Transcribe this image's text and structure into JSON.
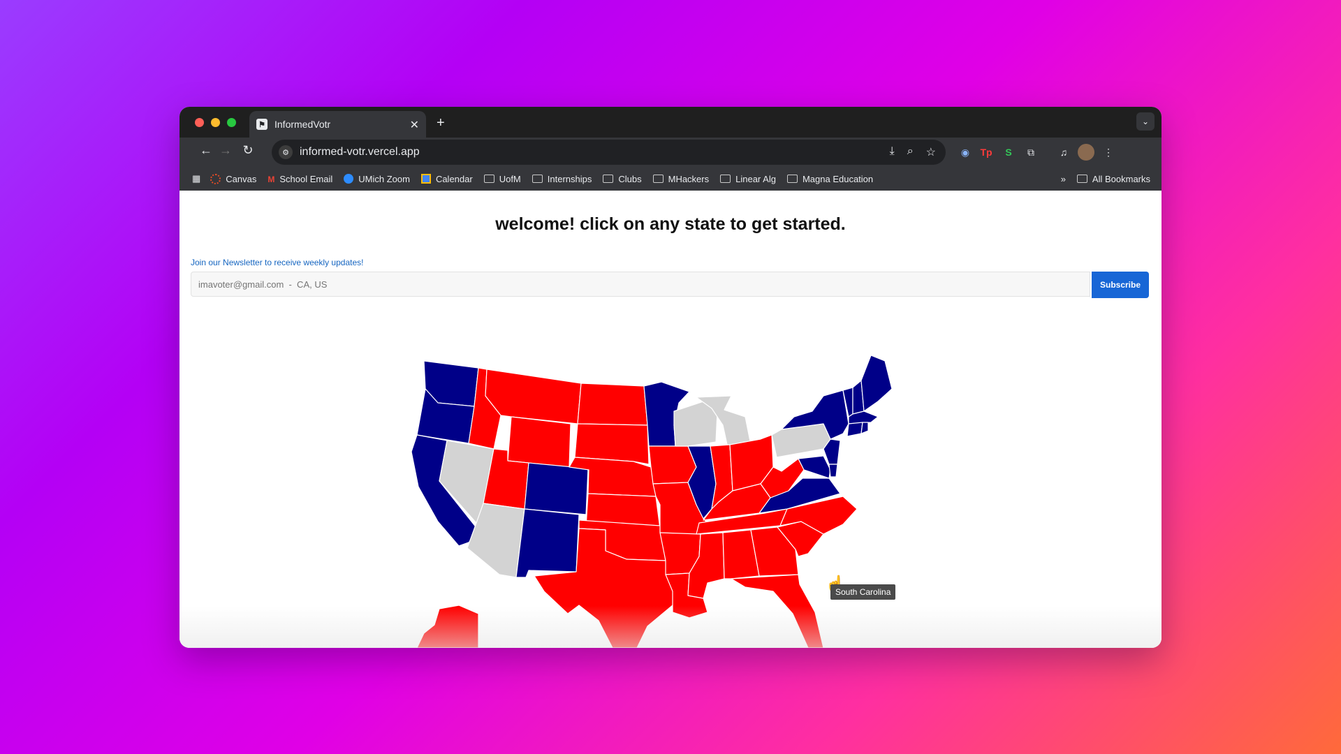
{
  "browser": {
    "tab_title": "InformedVotr",
    "url": "informed-votr.vercel.app",
    "bookmarks": [
      {
        "label": "Canvas",
        "icon": "canvas-icon"
      },
      {
        "label": "School Email",
        "icon": "gmail-icon"
      },
      {
        "label": "UMich Zoom",
        "icon": "zoom-icon"
      },
      {
        "label": "Calendar",
        "icon": "calendar-icon"
      },
      {
        "label": "UofM",
        "icon": "folder-icon"
      },
      {
        "label": "Internships",
        "icon": "folder-icon"
      },
      {
        "label": "Clubs",
        "icon": "folder-icon"
      },
      {
        "label": "MHackers",
        "icon": "folder-icon"
      },
      {
        "label": "Linear Alg",
        "icon": "folder-icon"
      },
      {
        "label": "Magna Education",
        "icon": "folder-icon"
      }
    ],
    "all_bookmarks": "All Bookmarks"
  },
  "page": {
    "heading": "welcome! click on any state to get started.",
    "newsletter_label": "Join our Newsletter to receive weekly updates!",
    "newsletter_placeholder": "imavoter@gmail.com  -  CA, US",
    "subscribe_label": "Subscribe",
    "tooltip": "South Carolina"
  },
  "colors": {
    "red": "#ff0000",
    "blue": "#000088",
    "gray": "#d3d3d3",
    "accent": "#1766d6"
  }
}
